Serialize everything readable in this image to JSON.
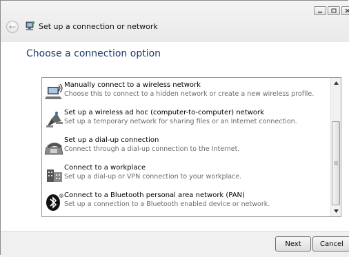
{
  "window": {
    "title": "Set up a connection or network",
    "back_glyph": "←",
    "caption_buttons": [
      "minimize",
      "maximize",
      "close"
    ]
  },
  "heading": "Choose a connection option",
  "options": [
    {
      "label": "Manually connect to a wireless network",
      "description": "Choose this to connect to a hidden network or create a new wireless profile.",
      "icon": "wireless-network-icon"
    },
    {
      "label": "Set up a wireless ad hoc (computer-to-computer) network",
      "description": "Set up a temporary network for sharing files or an Internet connection.",
      "icon": "ad-hoc-network-icon"
    },
    {
      "label": "Set up a dial-up connection",
      "description": "Connect through a dial-up connection to the Internet.",
      "icon": "dial-up-phone-icon"
    },
    {
      "label": "Connect to a workplace",
      "description": "Set up a dial-up or VPN connection to your workplace.",
      "icon": "workplace-vpn-icon"
    },
    {
      "label": "Connect to a Bluetooth personal area network (PAN)",
      "description": "Set up a connection to a Bluetooth enabled device or network.",
      "icon": "bluetooth-icon"
    }
  ],
  "buttons": {
    "next": "Next",
    "cancel": "Cancel"
  }
}
